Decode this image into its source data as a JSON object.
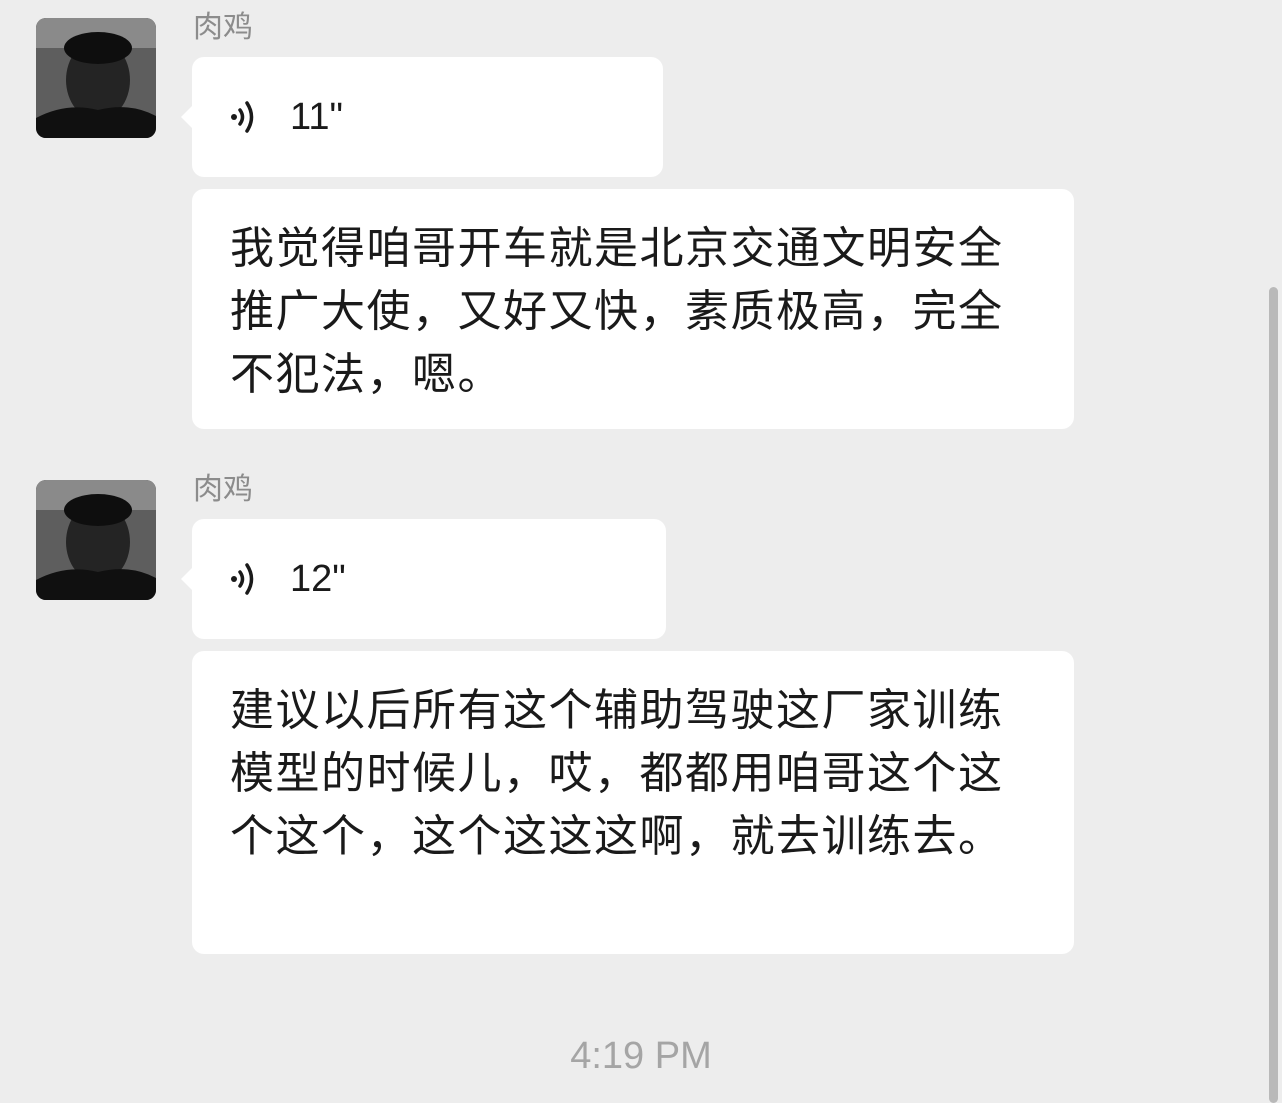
{
  "messages": [
    {
      "sender": "肉鸡",
      "voice_duration": "11\"",
      "transcript": "我觉得咱哥开车就是北京交通文明安全推广大使，又好又快，素质极高，完全不犯法，嗯。"
    },
    {
      "sender": "肉鸡",
      "voice_duration": "12\"",
      "transcript": "建议以后所有这个辅助驾驶这厂家训练模型的时候儿，哎，都都用咱哥这个这个这个，这个这这这啊，就去训练去。"
    }
  ],
  "timestamp": "4:19 PM",
  "colors": {
    "background": "#ededed",
    "bubble": "#ffffff",
    "sender_name": "#8c8c8c",
    "text": "#1a1a1a",
    "timestamp": "#a5a5a5"
  },
  "icons": {
    "voice": "voice-wave-icon",
    "avatar": "user-avatar"
  }
}
